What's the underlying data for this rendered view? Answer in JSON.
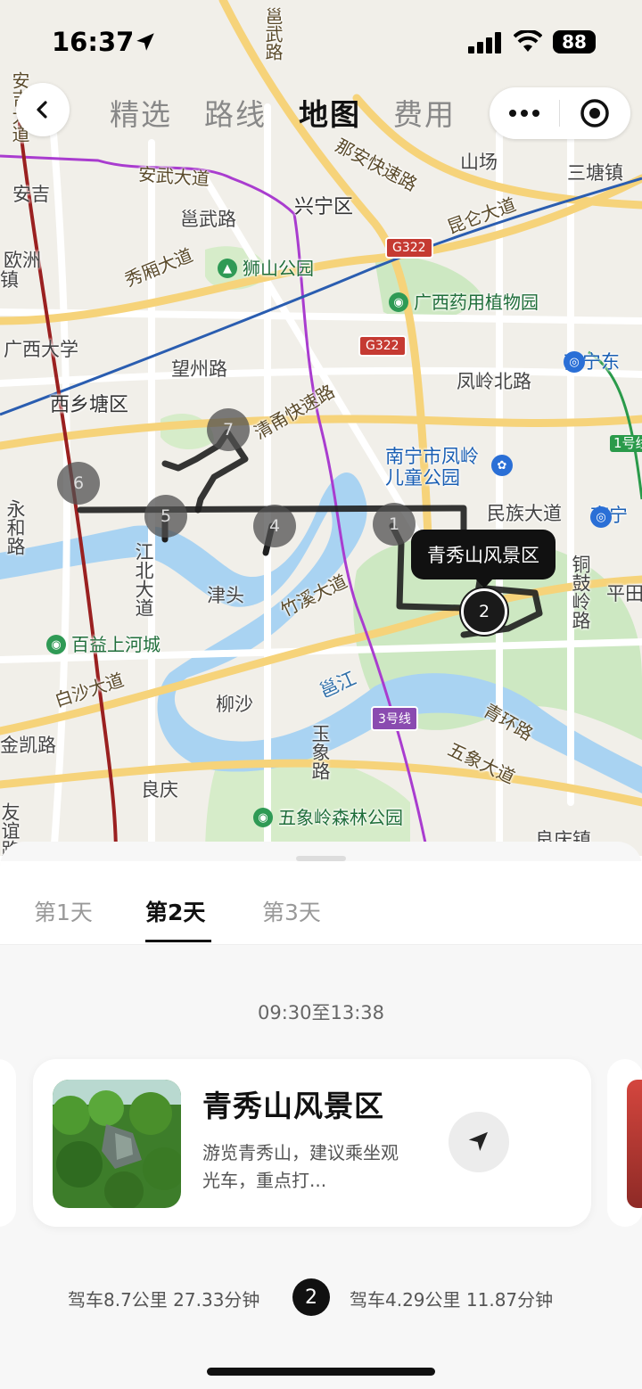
{
  "status_bar": {
    "time": "16:37",
    "battery": "88"
  },
  "header": {
    "tabs": [
      {
        "label": "精选",
        "active": false
      },
      {
        "label": "路线",
        "active": false
      },
      {
        "label": "地图",
        "active": true
      },
      {
        "label": "费用",
        "active": false
      }
    ]
  },
  "map": {
    "labels": {
      "anji_avenue": "安吉大道",
      "yongwu": "邕武路",
      "naan_expressway": "那安快速路",
      "shanchang": "山场",
      "santang": "三塘镇",
      "anwu_avenue": "安武大道",
      "anji": "安吉",
      "yongwu_road": "邕武路",
      "xingning": "兴宁区",
      "kunlun_avenue": "昆仑大道",
      "europe": "欧洲",
      "zhen": "镇",
      "xiuxiang_avenue": "秀厢大道",
      "shishan_park": "狮山公园",
      "guangxi_botanic": "广西药用植物园",
      "guangxi_univ": "广西大学",
      "wangzhou_road": "望州路",
      "nanning_east": "南宁东",
      "xixiangtang": "西乡塘区",
      "qingyong_expressway": "清甬快速路",
      "fengling_north": "凤岭北路",
      "line1": "1号线",
      "fengling_children_park": "南宁市凤岭儿童公园",
      "yonghe_road": "永和路",
      "minzu_avenue": "民族大道",
      "nanning_station": "南宁",
      "jiangbei_avenue": "江北大道",
      "tonggu_ridge": "铜鼓岭路",
      "pingtian": "平田",
      "jintou": "津头",
      "zhuxi_avenue": "竹溪大道",
      "baiyi_shanghe": "百益上河城",
      "baisha_avenue": "白沙大道",
      "yongjiang": "邕江",
      "liusha": "柳沙",
      "line3": "3号线",
      "qinghuan_road": "青环路",
      "jinkai_road": "金凯路",
      "yuxiang_road": "玉象路",
      "wuxiang_avenue": "五象大道",
      "liangqing": "良庆",
      "wuxiangling_park": "五象岭森林公园",
      "youyi_road": "友谊路",
      "ziqing": "良庆镇"
    },
    "shields": {
      "g322_a": "G322",
      "g322_b": "G322",
      "line3": "3号线"
    },
    "markers": [
      {
        "num": "7",
        "state": "past"
      },
      {
        "num": "6",
        "state": "past"
      },
      {
        "num": "5",
        "state": "past"
      },
      {
        "num": "4",
        "state": "past"
      },
      {
        "num": "1",
        "state": "past"
      },
      {
        "num": "2",
        "state": "current"
      }
    ],
    "callout": "青秀山风景区"
  },
  "sheet": {
    "days": [
      {
        "label": "第1天",
        "active": false
      },
      {
        "label": "第2天",
        "active": true
      },
      {
        "label": "第3天",
        "active": false
      }
    ],
    "time_range": "09:30至13:38",
    "card": {
      "title": "青秀山风景区",
      "desc": "游览青秀山，建议乘坐观光车，重点打..."
    },
    "legs": {
      "before": "驾车8.7公里 27.33分钟",
      "num": "2",
      "after": "驾车4.29公里 11.87分钟"
    }
  },
  "colors": {
    "accent": "#111111",
    "park_green": "#cde8c2",
    "water": "#a9d3f2"
  }
}
